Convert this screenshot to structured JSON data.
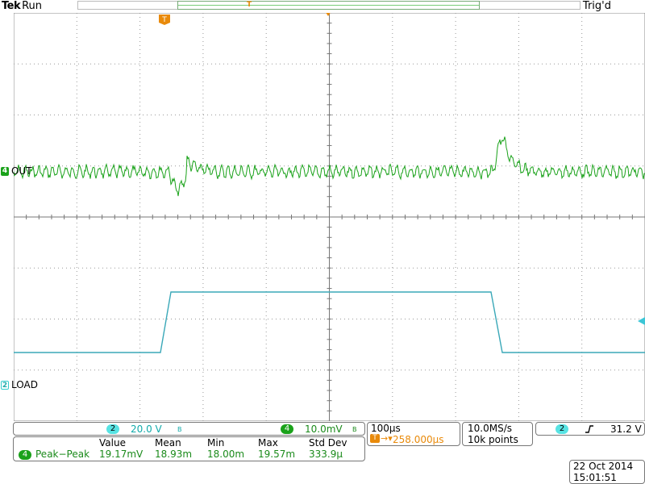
{
  "header": {
    "brand": "Tek",
    "run_state": "Run",
    "trigger_status": "Trig'd"
  },
  "channels": {
    "ch4": {
      "number": "4",
      "label": "OUT",
      "color": "#1aa21a"
    },
    "ch2": {
      "number": "2",
      "label": "LOAD",
      "color": "#3aa8b8"
    }
  },
  "vertical": {
    "ch2_scale": "20.0 V",
    "ch2_bw": "B",
    "ch4_scale": "10.0mV",
    "ch4_bw": "B"
  },
  "timebase": {
    "scale": "100µs",
    "position": "258.000µs",
    "marker_icon": "trigger-position-icon"
  },
  "acquisition": {
    "sample_rate": "10.0MS/s",
    "record_length": "10k points"
  },
  "trigger": {
    "source": "2",
    "slope_icon": "rising-edge-icon",
    "level": "31.2 V"
  },
  "measurements": {
    "headers": [
      "Value",
      "Mean",
      "Min",
      "Max",
      "Std Dev"
    ],
    "rows": [
      {
        "channel": "4",
        "name": "Peak−Peak",
        "values": [
          "19.17mV",
          "18.93m",
          "18.00m",
          "19.57m",
          "333.9µ"
        ]
      }
    ]
  },
  "datetime": {
    "date": "22 Oct  2014",
    "time": "15:01:51"
  },
  "colors": {
    "ch4": "#1aa21a",
    "ch2": "#3aa8b8",
    "trigger_marker": "#e98a0a"
  }
}
